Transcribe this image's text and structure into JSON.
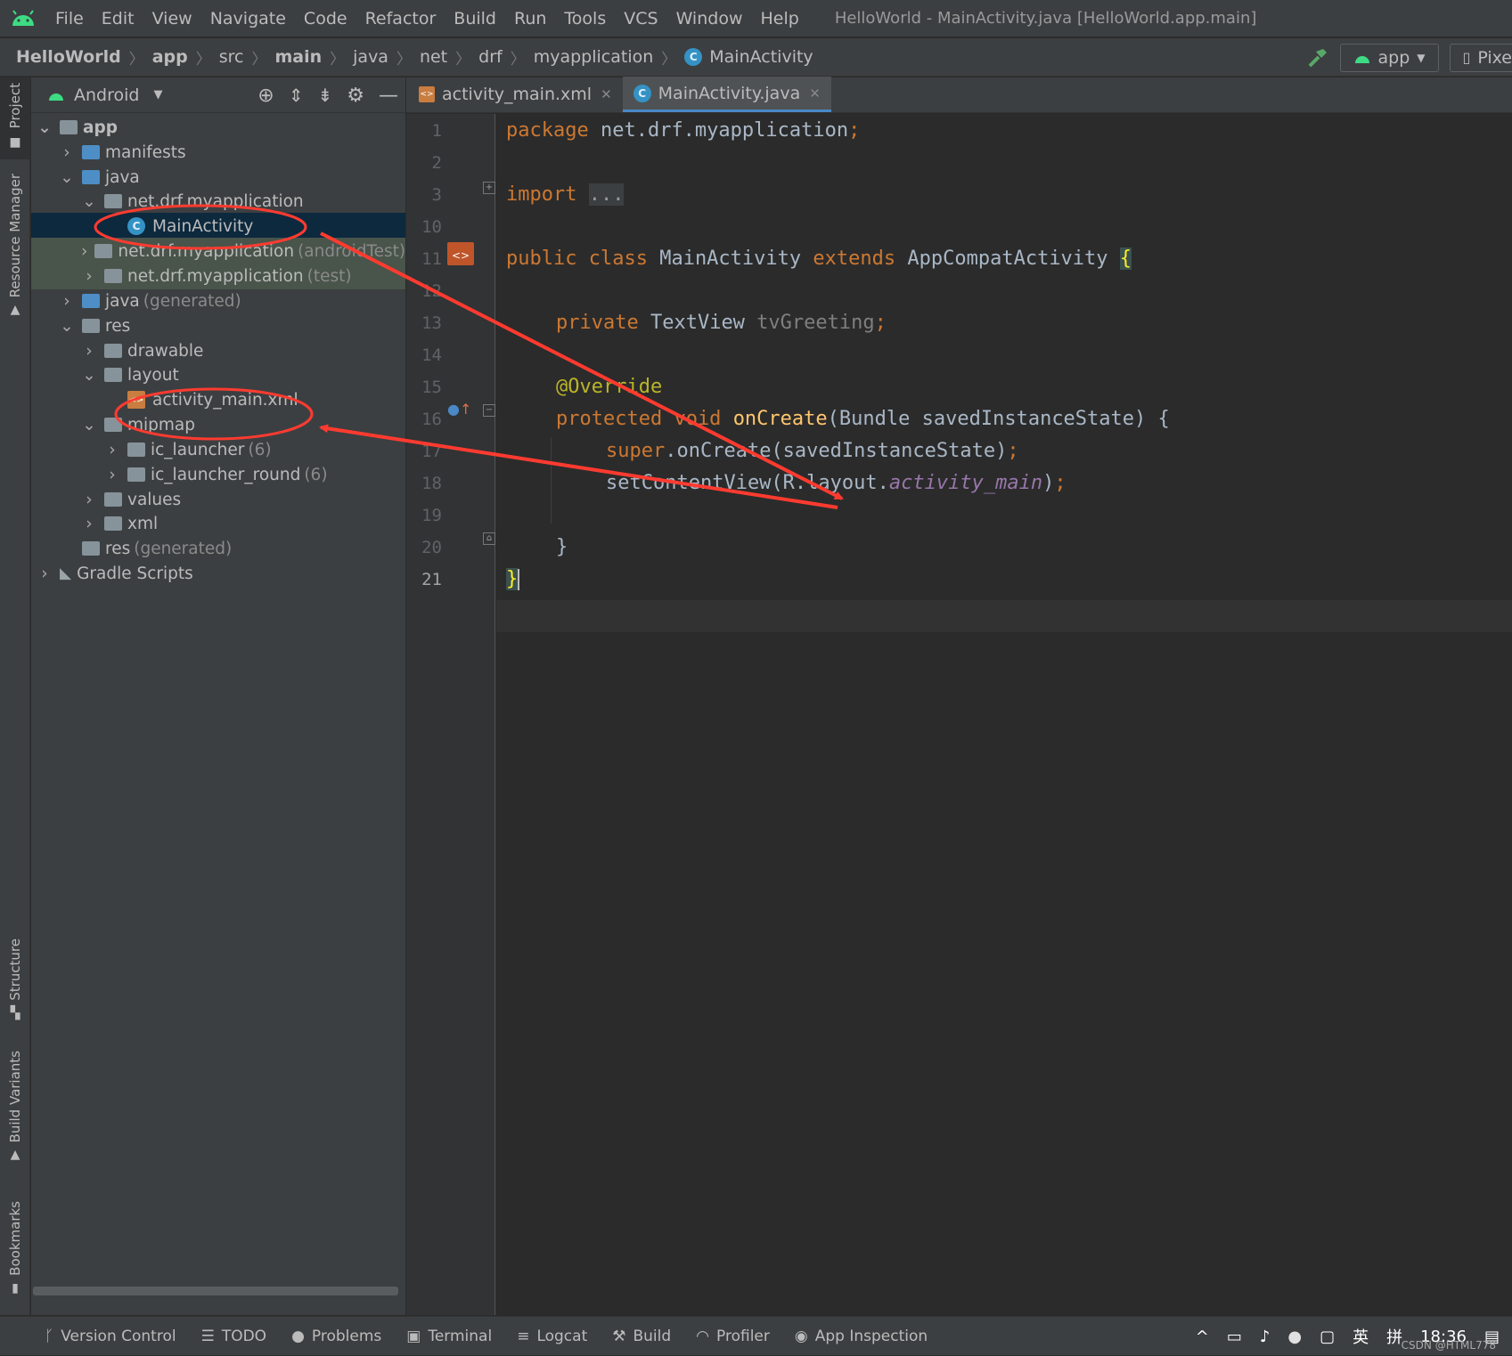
{
  "menubar": {
    "items": [
      "File",
      "Edit",
      "View",
      "Navigate",
      "Code",
      "Refactor",
      "Build",
      "Run",
      "Tools",
      "VCS",
      "Window",
      "Help"
    ],
    "window_title": "HelloWorld - MainActivity.java [HelloWorld.app.main]"
  },
  "breadcrumb": [
    "HelloWorld",
    "app",
    "src",
    "main",
    "java",
    "net",
    "drf",
    "myapplication",
    "MainActivity"
  ],
  "toolbar": {
    "run_config": "app",
    "device": "Pixe"
  },
  "left_tools": {
    "project": "Project",
    "resource_manager": "Resource Manager",
    "structure": "Structure",
    "build_variants": "Build Variants",
    "bookmarks": "Bookmarks"
  },
  "project_panel": {
    "view": "Android",
    "tree": [
      {
        "label": "app"
      },
      {
        "label": "manifests"
      },
      {
        "label": "java"
      },
      {
        "label": "net.drf.myapplication"
      },
      {
        "label": "MainActivity"
      },
      {
        "label": "net.drf.myapplication",
        "hint": "(androidTest)"
      },
      {
        "label": "net.drf.myapplication",
        "hint": "(test)"
      },
      {
        "label": "java",
        "hint": "(generated)"
      },
      {
        "label": "res"
      },
      {
        "label": "drawable"
      },
      {
        "label": "layout"
      },
      {
        "label": "activity_main.xml"
      },
      {
        "label": "mipmap"
      },
      {
        "label": "ic_launcher",
        "hint": "(6)"
      },
      {
        "label": "ic_launcher_round",
        "hint": "(6)"
      },
      {
        "label": "values"
      },
      {
        "label": "xml"
      },
      {
        "label": "res",
        "hint": "(generated)"
      },
      {
        "label": "Gradle Scripts"
      }
    ]
  },
  "editor": {
    "tabs": [
      "activity_main.xml",
      "MainActivity.java"
    ],
    "active_tab": "MainActivity.java",
    "line_numbers": [
      "1",
      "2",
      "3",
      "10",
      "11",
      "12",
      "13",
      "14",
      "15",
      "16",
      "17",
      "18",
      "19",
      "20",
      "21"
    ],
    "code": {
      "package_kw": "package",
      "package_name": "net.drf.myapplication",
      "semicolon": ";",
      "import_kw": "import",
      "import_fold": "...",
      "public_class": "public class",
      "class_name": "MainActivity",
      "extends_kw": "extends",
      "super_class": "AppCompatActivity",
      "open_brace": "{",
      "private_kw": "private",
      "tv_type": "TextView",
      "tv_field": "tvGreeting",
      "override": "@Override",
      "protected_void": "protected void",
      "oncreate": "onCreate",
      "params": "(Bundle savedInstanceState) {",
      "super_kw": "super",
      "super_call": ".onCreate(savedInstanceState)",
      "setcontent": "setContentView(R.layout.",
      "layout_name": "activity_main",
      "close_paren": ")",
      "close_brace": "}"
    }
  },
  "bottom_tools": [
    "Version Control",
    "TODO",
    "Problems",
    "Terminal",
    "Logcat",
    "Build",
    "Profiler",
    "App Inspection"
  ],
  "tray": {
    "ime_lang": "英",
    "ime_mode": "拼",
    "time": "18:36",
    "watermark": "CSDN @HTML778"
  },
  "colors": {
    "annotation": "#ff3b30",
    "selection": "#0d293e",
    "keyword": "#cc7832"
  }
}
